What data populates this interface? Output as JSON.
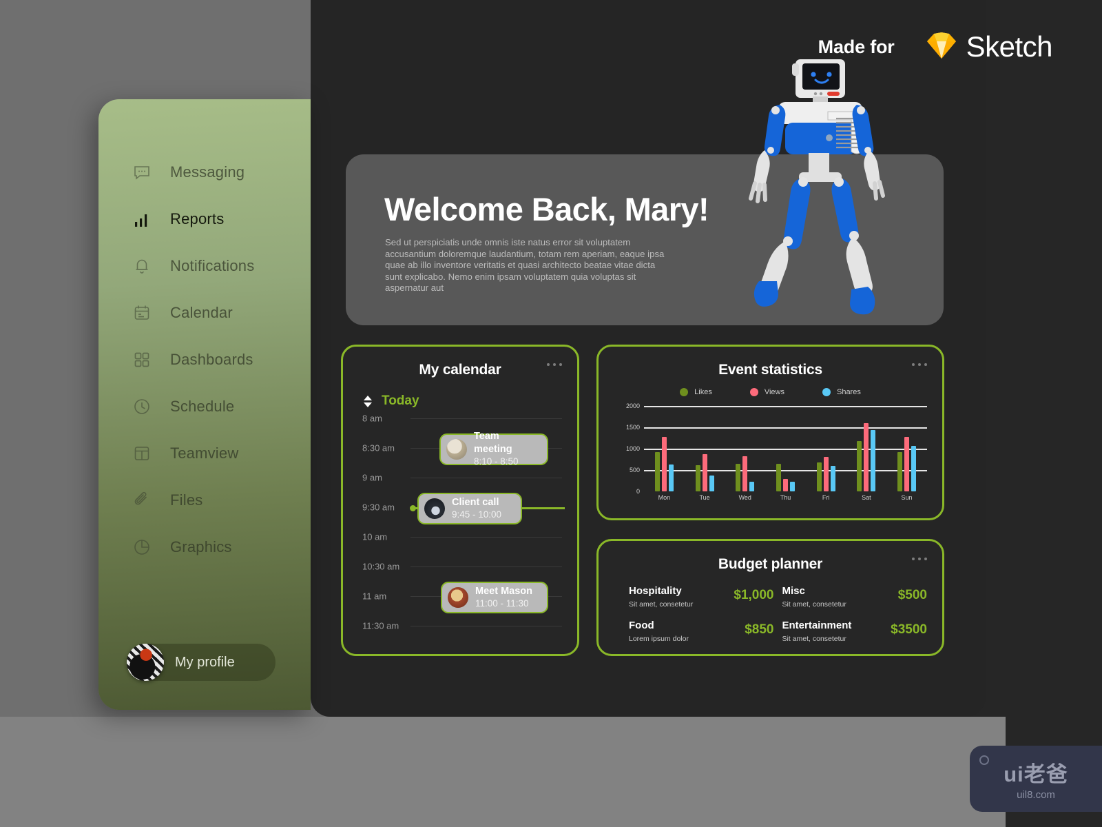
{
  "branding": {
    "made_for": "Made for",
    "product": "Sketch"
  },
  "sidebar": {
    "items": [
      {
        "label": "Messaging",
        "icon": "message-icon",
        "active": false
      },
      {
        "label": "Reports",
        "icon": "bar-chart-icon",
        "active": true
      },
      {
        "label": "Notifications",
        "icon": "bell-icon",
        "active": false
      },
      {
        "label": "Calendar",
        "icon": "calendar-icon",
        "active": false
      },
      {
        "label": "Dashboards",
        "icon": "grid-icon",
        "active": false
      },
      {
        "label": "Schedule",
        "icon": "clock-icon",
        "active": false
      },
      {
        "label": "Teamview",
        "icon": "layout-icon",
        "active": false
      },
      {
        "label": "Files",
        "icon": "paperclip-icon",
        "active": false
      },
      {
        "label": "Graphics",
        "icon": "pie-chart-icon",
        "active": false
      }
    ],
    "profile": {
      "label": "My profile",
      "avatar": "user-avatar"
    }
  },
  "hero": {
    "title": "Welcome Back, Mary!",
    "body": "Sed ut perspiciatis unde omnis iste natus error sit voluptatem accusantium doloremque laudantium, totam rem aperiam, eaque ipsa quae ab illo inventore veritatis et quasi architecto beatae vitae dicta sunt explicabo. Nemo enim ipsam voluptatem quia voluptas sit aspernatur aut"
  },
  "calendar": {
    "title": "My calendar",
    "today_label": "Today",
    "slots": [
      "8 am",
      "8:30 am",
      "9 am",
      "9:30 am",
      "10 am",
      "10:30 am",
      "11 am",
      "11:30 am"
    ],
    "events": [
      {
        "name": "Team meeting",
        "time": "8:10 - 8:50",
        "avatar": "team-avatar"
      },
      {
        "name": "Client call",
        "time": "9:45 - 10:00",
        "avatar": "client-avatar"
      },
      {
        "name": "Meet Mason",
        "time": "11:00 - 11:30",
        "avatar": "mason-avatar"
      }
    ]
  },
  "stats": {
    "title": "Event statistics"
  },
  "chart_data": {
    "type": "bar",
    "title": "Event statistics",
    "categories": [
      "Mon",
      "Tue",
      "Wed",
      "Thu",
      "Fri",
      "Sat",
      "Sun"
    ],
    "series": [
      {
        "name": "Likes",
        "color": "#6f8f1e",
        "values": [
          920,
          620,
          650,
          650,
          680,
          1170,
          920
        ]
      },
      {
        "name": "Views",
        "color": "#fd6b7b",
        "values": [
          1270,
          870,
          820,
          290,
          800,
          1600,
          1270
        ]
      },
      {
        "name": "Shares",
        "color": "#59c8f5",
        "values": [
          630,
          370,
          230,
          220,
          600,
          1440,
          1060
        ]
      }
    ],
    "ylim": [
      0,
      2000
    ],
    "yticks": [
      0,
      500,
      1000,
      1500,
      2000
    ],
    "ytick_labels": [
      "0",
      "500",
      "1000",
      "1500",
      "2000"
    ],
    "xlabel": "",
    "ylabel": "",
    "grid": true,
    "legend_position": "top"
  },
  "budget": {
    "title": "Budget planner",
    "items": [
      {
        "name": "Hospitality",
        "sub": "Sit amet, consetetur",
        "amount": "$1,000"
      },
      {
        "name": "Misc",
        "sub": "Sit amet, consetetur",
        "amount": "$500"
      },
      {
        "name": "Food",
        "sub": "Lorem ipsum dolor",
        "amount": "$850"
      },
      {
        "name": "Entertainment",
        "sub": "Sit amet, consetetur",
        "amount": "$3500"
      }
    ]
  },
  "watermark": {
    "main": "ui老爸",
    "sub": "uil8.com"
  },
  "colors": {
    "accent_green": "#8ab828",
    "sidebar_top": "#a7bd88",
    "sidebar_bottom": "#4d5933",
    "likes": "#6f8f1e",
    "views": "#fd6b7b",
    "shares": "#59c8f5",
    "card_bg": "#262626",
    "hero_bg": "#585858"
  }
}
